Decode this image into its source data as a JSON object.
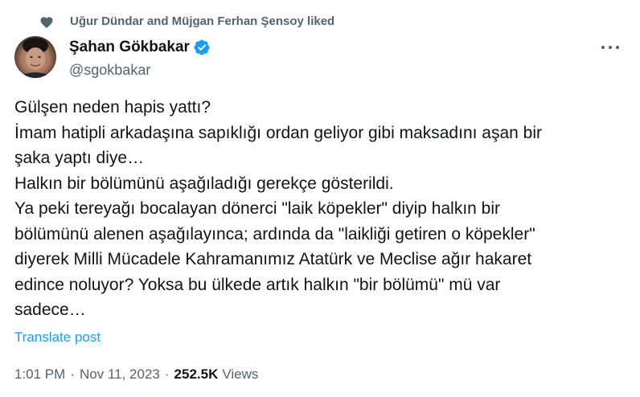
{
  "social_context": {
    "icon": "heart-icon",
    "text": "Uğur Dündar and Müjgan Ferhan Şensoy liked"
  },
  "author": {
    "display_name": "Şahan Gökbakar",
    "handle": "@sgokbakar",
    "verified": true,
    "verified_color": "#1d9bf0"
  },
  "tweet": {
    "lines": [
      "Gülşen neden hapis yattı?",
      "İmam hatipli arkadaşına sapıklığı ordan geliyor gibi maksadını aşan bir",
      "şaka yaptı diye…",
      "Halkın bir bölümünü aşağıladığı gerekçe gösterildi.",
      "Ya peki tereyağı bocalayan dönerci \"laik köpekler\" diyip halkın bir",
      "bölümünü alenen aşağılayınca; ardında da \"laikliği getiren o köpekler\"",
      "diyerek Milli Mücadele Kahramanımız Atatürk ve Meclise ağır hakaret",
      "edince noluyor? Yoksa bu ülkede artık halkın \"bir bölümü\" mü var",
      "sadece…"
    ],
    "translate_label": "Translate post"
  },
  "meta": {
    "time": "1:01 PM",
    "separator": "·",
    "date": "Nov 11, 2023",
    "views_count": "252.5K",
    "views_label": "Views"
  },
  "colors": {
    "text_primary": "#0f1419",
    "text_secondary": "#536471",
    "link": "#1d9bf0"
  }
}
